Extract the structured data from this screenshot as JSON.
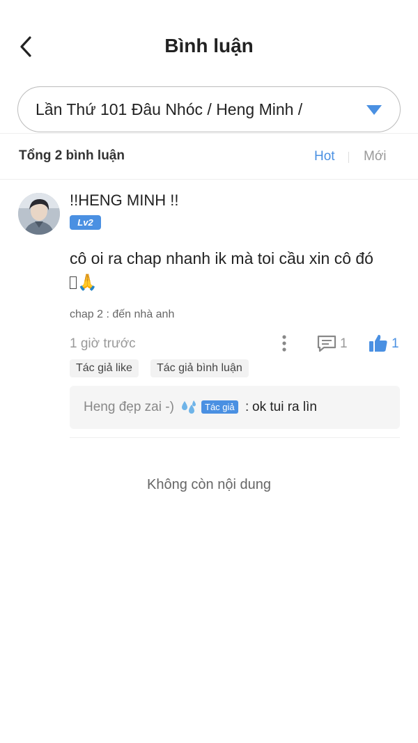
{
  "header": {
    "title": "Bình luận",
    "back_icon": "chevron-left-icon"
  },
  "chapter_select": {
    "value": "Lần Thứ 101 Đâu Nhóc / Heng Minh /",
    "icon": "caret-down-icon",
    "icon_color": "#4a90e2"
  },
  "list_header": {
    "count_label": "Tổng 2 bình luận",
    "sort_hot": "Hot",
    "sort_new": "Mới",
    "active_sort": "Hot",
    "accent_color": "#4a90e2"
  },
  "comment": {
    "username": "!!HENG MINH !!",
    "level": "Lv2",
    "text": "cô oi ra chap nhanh ik mà toi cầu xin cô đó",
    "text_emoji": "🙏",
    "chapter_ref": "chap 2 : đến nhà anh",
    "time": "1 giờ trước",
    "reply_count": "1",
    "like_count": "1",
    "tags": [
      "Tác giả like",
      "Tác giả bình luận"
    ],
    "reply": {
      "author": "Heng đẹp zai -)",
      "author_badge": "Tác giả",
      "separator": ":",
      "text": "ok tui ra lìn"
    }
  },
  "footer": {
    "end_text": "Không còn nội dung"
  }
}
